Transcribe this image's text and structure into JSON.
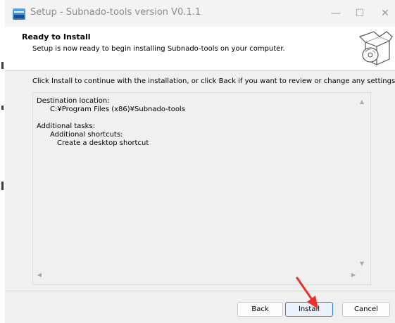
{
  "window": {
    "title": "Setup - Subnado-tools version V0.1.1"
  },
  "title_bar": {
    "minimize_glyph": "—",
    "maximize_glyph": "☐",
    "close_glyph": "✕"
  },
  "header": {
    "title": "Ready to Install",
    "subtitle": "Setup is now ready to begin installing Subnado-tools on your computer.",
    "icon": "box-install-icon"
  },
  "main": {
    "instruction": "Click Install to continue with the installation, or click Back if you want to review or change any settings.",
    "summary": {
      "destination_label": "Destination location:",
      "destination_value": "C:¥Program Files (x86)¥Subnado-tools",
      "tasks_label": "Additional tasks:",
      "tasks_group": "Additional shortcuts:",
      "tasks_item": "Create a desktop shortcut"
    }
  },
  "buttons": {
    "back": "Back",
    "install": "Install",
    "cancel": "Cancel"
  },
  "colors": {
    "accent": "#2f7fd6",
    "annotation_arrow": "#e8322a"
  }
}
